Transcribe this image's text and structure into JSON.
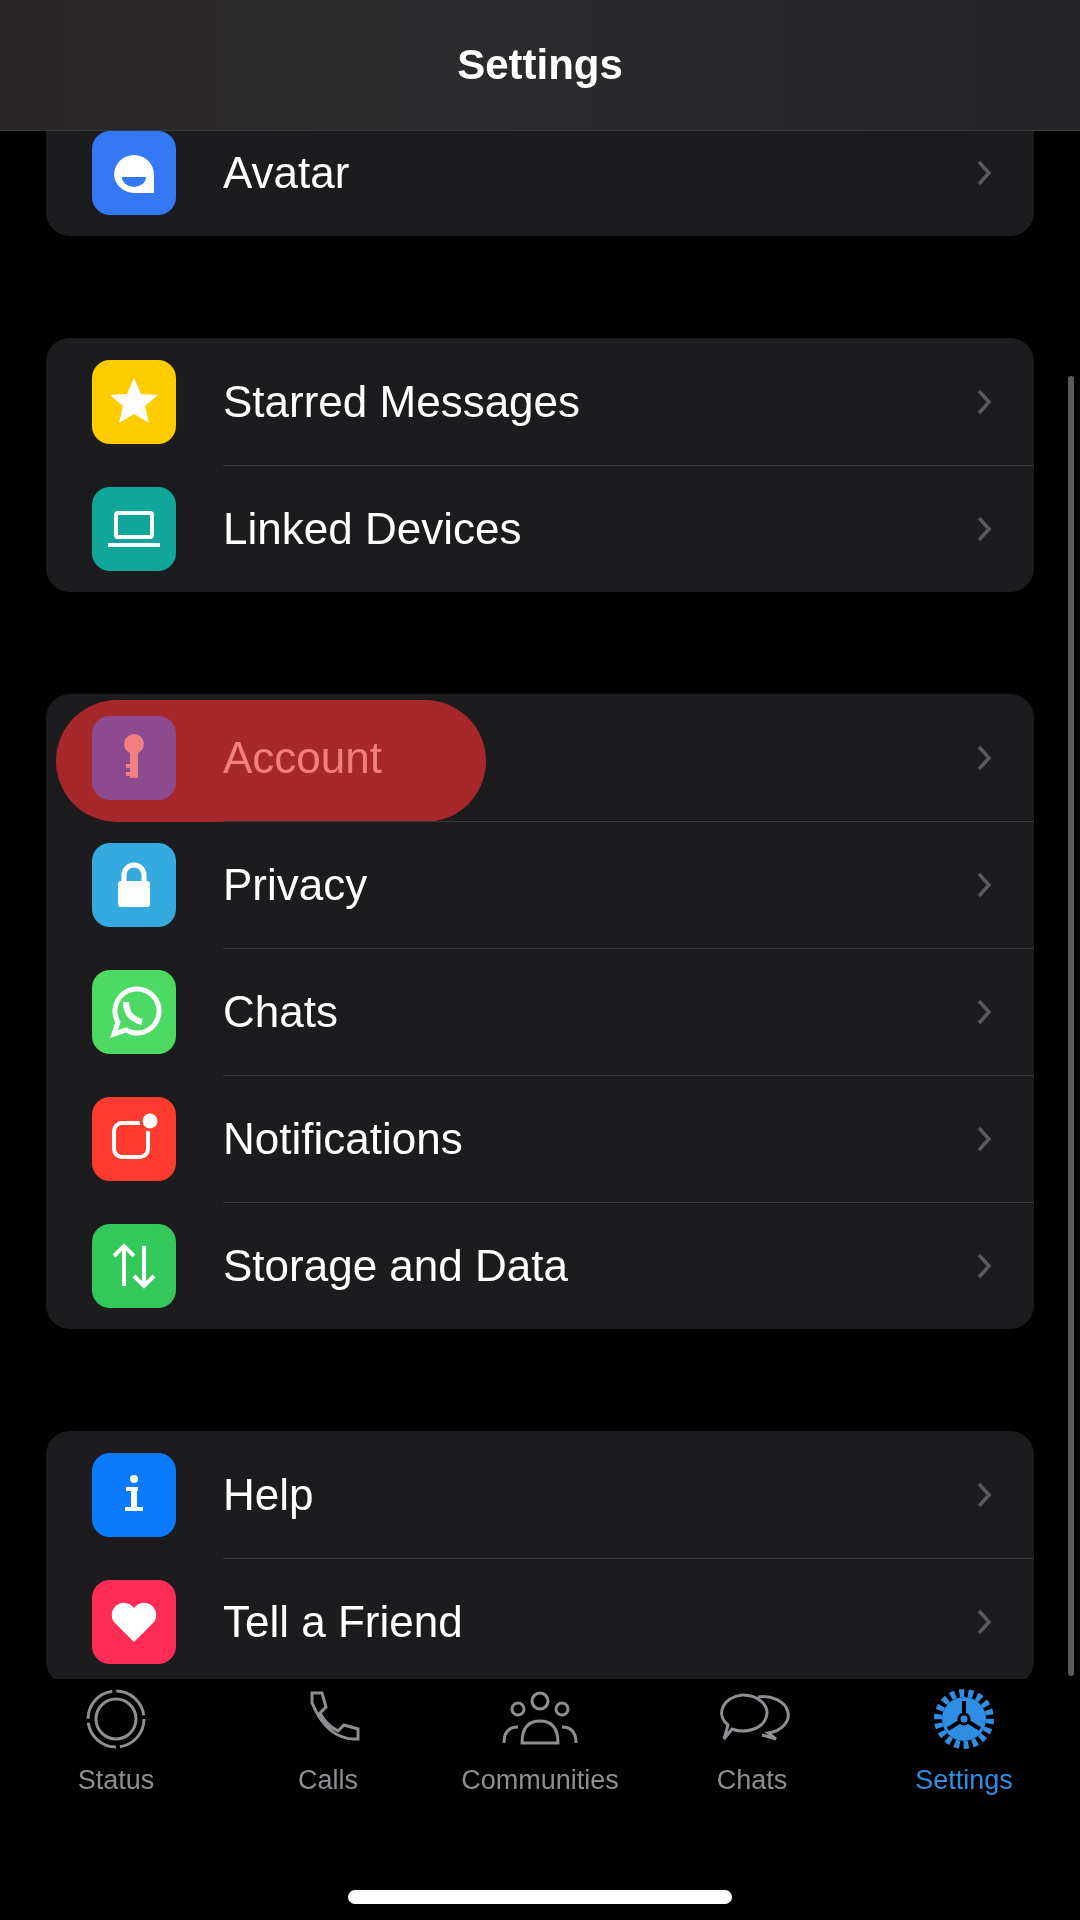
{
  "header": {
    "title": "Settings"
  },
  "groups": [
    {
      "items": [
        {
          "label": "Avatar",
          "kind": "avatar",
          "color": "#3478f6",
          "highlighted": false
        }
      ]
    },
    {
      "items": [
        {
          "label": "Starred Messages",
          "kind": "star",
          "color": "#ffcc00",
          "highlighted": false
        },
        {
          "label": "Linked Devices",
          "kind": "laptop",
          "color": "#10a79a",
          "highlighted": false
        }
      ]
    },
    {
      "items": [
        {
          "label": "Account",
          "kind": "key",
          "color": "#8e4a8e",
          "highlighted": true
        },
        {
          "label": "Privacy",
          "kind": "lock",
          "color": "#35aadf",
          "highlighted": false
        },
        {
          "label": "Chats",
          "kind": "whatsapp",
          "color": "#4cd964",
          "highlighted": false
        },
        {
          "label": "Notifications",
          "kind": "notification",
          "color": "#ff3b30",
          "highlighted": false
        },
        {
          "label": "Storage and Data",
          "kind": "arrows",
          "color": "#34c759",
          "highlighted": false
        }
      ]
    },
    {
      "items": [
        {
          "label": "Help",
          "kind": "info",
          "color": "#0a7aff",
          "highlighted": false
        },
        {
          "label": "Tell a Friend",
          "kind": "heart",
          "color": "#ff2d55",
          "highlighted": false
        }
      ]
    }
  ],
  "tabs": [
    {
      "label": "Status",
      "kind": "status",
      "selected": false
    },
    {
      "label": "Calls",
      "kind": "calls",
      "selected": false
    },
    {
      "label": "Communities",
      "kind": "communities",
      "selected": false
    },
    {
      "label": "Chats",
      "kind": "chats",
      "selected": false
    },
    {
      "label": "Settings",
      "kind": "settings",
      "selected": true
    }
  ]
}
